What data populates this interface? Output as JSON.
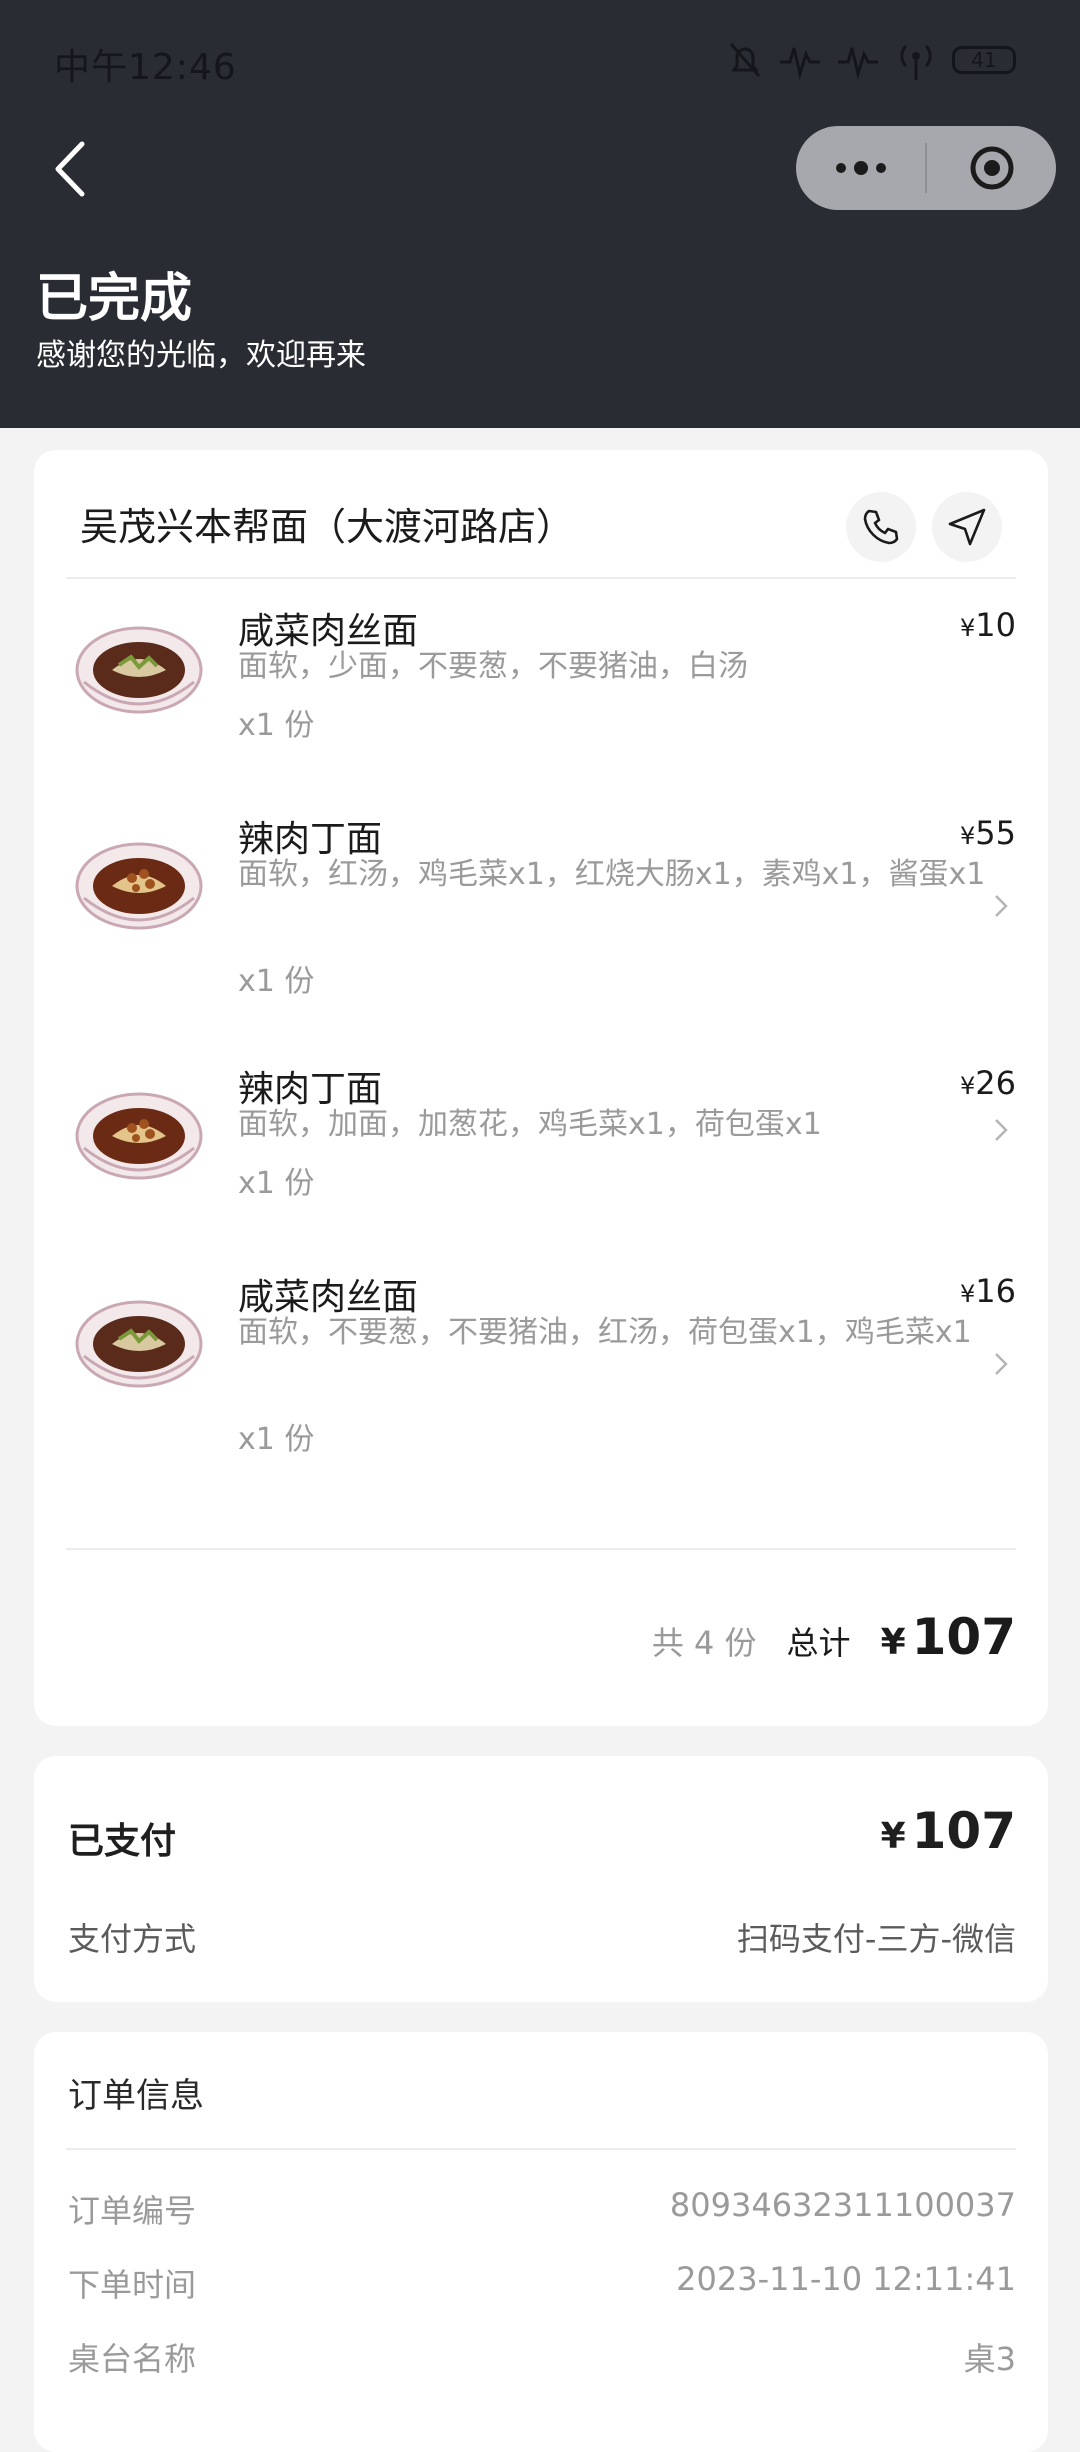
{
  "status_bar": {
    "time": "中午12:46",
    "battery": "41"
  },
  "header": {
    "title": "已完成",
    "subtitle": "感谢您的光临，欢迎再来"
  },
  "store": {
    "name": "吴茂兴本帮面（大渡河路店）"
  },
  "currency": "¥",
  "items": [
    {
      "name": "咸菜肉丝面",
      "desc": "面软，少面，不要葱，不要猪油，白汤",
      "qty": "x1 份",
      "price": "10"
    },
    {
      "name": "辣肉丁面",
      "desc": "面软，红汤，鸡毛菜x1，红烧大肠x1，素鸡x1，酱蛋x1",
      "qty": "x1 份",
      "price": "55"
    },
    {
      "name": "辣肉丁面",
      "desc": "面软，加面，加葱花，鸡毛菜x1，荷包蛋x1",
      "qty": "x1 份",
      "price": "26"
    },
    {
      "name": "咸菜肉丝面",
      "desc": "面软，不要葱，不要猪油，红汤，荷包蛋x1，鸡毛菜x1",
      "qty": "x1 份",
      "price": "16"
    }
  ],
  "summary": {
    "count": "共 4 份",
    "total_label": "总计",
    "total": "107"
  },
  "payment": {
    "status": "已支付",
    "amount": "107",
    "method_label": "支付方式",
    "method_value": "扫码支付-三方-微信"
  },
  "order_info": {
    "title": "订单信息",
    "rows": [
      {
        "label": "订单编号",
        "value": "80934632311100037"
      },
      {
        "label": "下单时间",
        "value": "2023-11-10 12:11:41"
      },
      {
        "label": "桌台名称",
        "value": "桌3"
      }
    ]
  }
}
